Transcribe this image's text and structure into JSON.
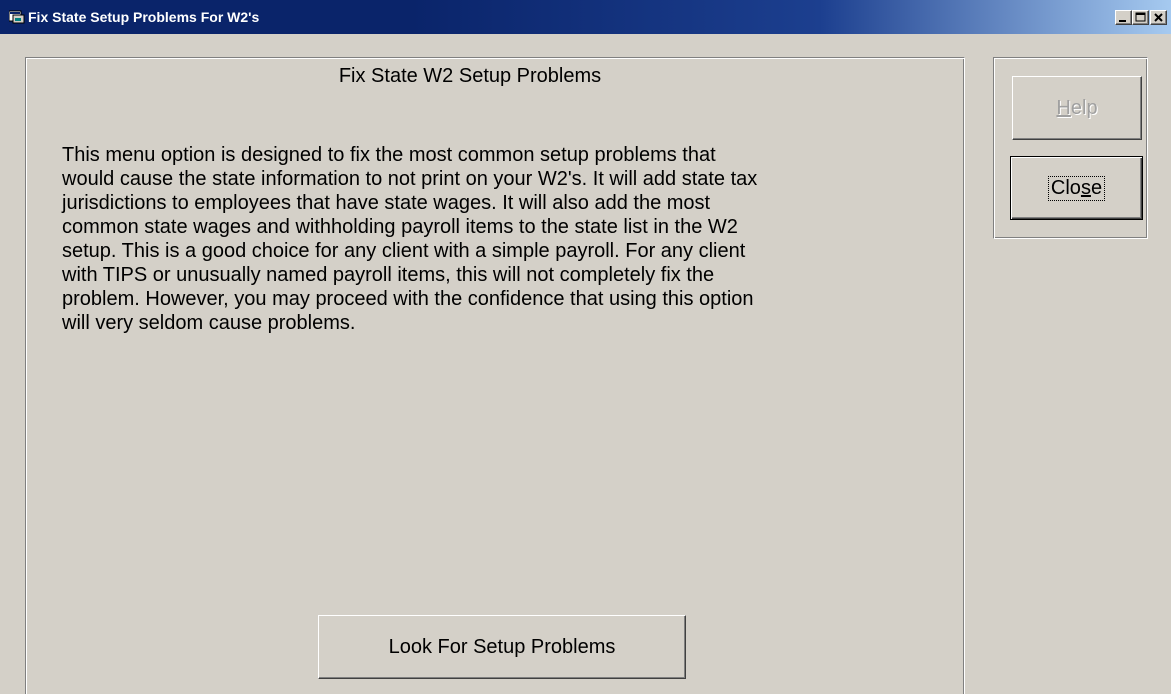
{
  "window": {
    "title": "Fix State Setup Problems For W2's",
    "icons": [
      "app-icon",
      "minimize-icon",
      "maximize-icon",
      "close-icon"
    ]
  },
  "main": {
    "heading": "Fix State W2 Setup Problems",
    "description_lines": [
      "This menu option is designed to fix the most common setup problems that",
      "would cause the state information to not print on your W2's.  It will add state tax",
      "jurisdictions to employees that have state wages.  It will also add the most",
      "common state wages and withholding payroll items to the state list in the W2",
      "setup.  This is a good choice for any client with a simple payroll.  For any client",
      "with TIPS or unusually named payroll items, this will not completely fix the",
      "problem.  However, you may proceed with the confidence that using this option",
      "will very seldom cause problems."
    ],
    "action_label": "Look For Setup Problems"
  },
  "side": {
    "help_label_first": "H",
    "help_label_rest": "elp",
    "close_label_a": "Clo",
    "close_label_b": "s",
    "close_label_c": "e"
  },
  "colors": {
    "titlebar_start": "#0a246a",
    "titlebar_end": "#a6caf0",
    "face": "#d4d0c8",
    "disabled_text": "#a0a0a0"
  }
}
